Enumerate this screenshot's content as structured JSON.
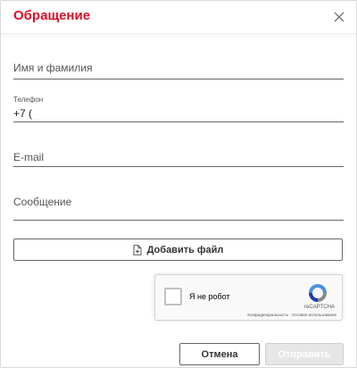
{
  "dialog": {
    "title": "Обращение",
    "close_icon": "close-icon",
    "accent_color": "#d7102a"
  },
  "form": {
    "name": {
      "placeholder": "Имя и фамилия",
      "value": ""
    },
    "phone": {
      "label": "Телефон",
      "value": "+7 ("
    },
    "email": {
      "placeholder": "E-mail",
      "value": ""
    },
    "message": {
      "placeholder": "Сообщение",
      "value": ""
    },
    "add_file": {
      "label": "Добавить файл",
      "icon": "file-add-icon"
    }
  },
  "captcha": {
    "label": "Я не робот",
    "brand": "reCAPTCHA",
    "links": "Конфиденциальность - Условия использования",
    "checked": false
  },
  "actions": {
    "cancel_label": "Отмена",
    "submit_label": "Отправить",
    "submit_disabled": true
  }
}
